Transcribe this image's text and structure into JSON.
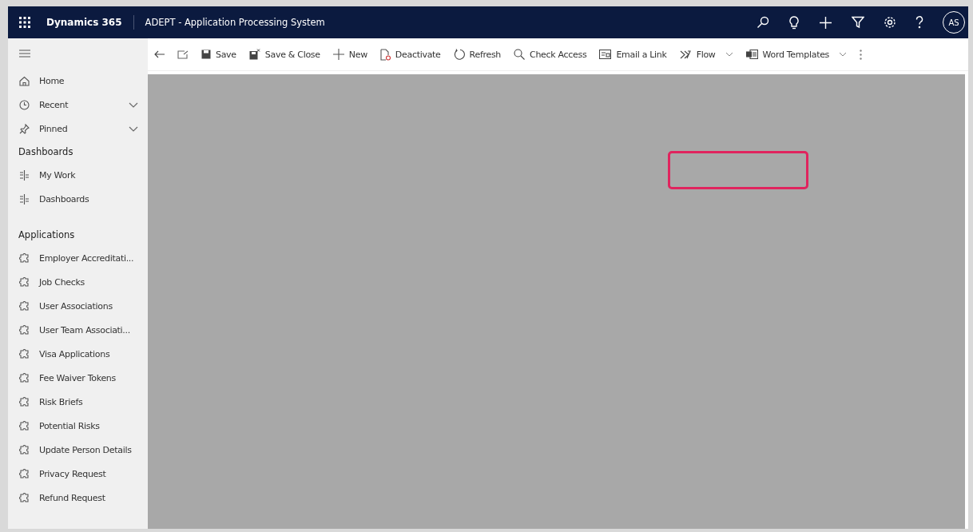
{
  "header": {
    "app_name": "Dynamics 365",
    "title": "ADEPT - Application Processing System",
    "avatar": "AS"
  },
  "toolbar": [
    {
      "kind": "save",
      "label": "Save",
      "dropdown": false
    },
    {
      "kind": "save-close",
      "label": "Save & Close",
      "dropdown": false
    },
    {
      "kind": "new",
      "label": "New",
      "dropdown": false
    },
    {
      "kind": "deactivate",
      "label": "Deactivate",
      "dropdown": false
    },
    {
      "kind": "refresh",
      "label": "Refresh",
      "dropdown": false
    },
    {
      "kind": "check-access",
      "label": "Check Access",
      "dropdown": false
    },
    {
      "kind": "email",
      "label": "Email a Link",
      "dropdown": false
    },
    {
      "kind": "flow",
      "label": "Flow",
      "dropdown": true
    },
    {
      "kind": "word",
      "label": "Word Templates",
      "dropdown": true
    }
  ],
  "sidebar": {
    "nav": [
      {
        "kind": "home",
        "label": "Home",
        "expandable": false
      },
      {
        "kind": "recent",
        "label": "Recent",
        "expandable": true
      },
      {
        "kind": "pinned",
        "label": "Pinned",
        "expandable": true
      }
    ],
    "sections": [
      {
        "title": "Dashboards",
        "kind": "dashboard",
        "items": [
          "My Work",
          "Dashboards"
        ]
      },
      {
        "title": "Applications",
        "kind": "entity",
        "items": [
          "Employer Accreditati...",
          "Job Checks",
          "User Associations",
          "User Team Associati...",
          "Visa Applications",
          "Fee Waiver Tokens",
          "Risk Briefs",
          "Potential Risks",
          "Update Person Details",
          "Privacy Request",
          "Refund Request"
        ]
      }
    ]
  },
  "content": {
    "highlight": true
  }
}
